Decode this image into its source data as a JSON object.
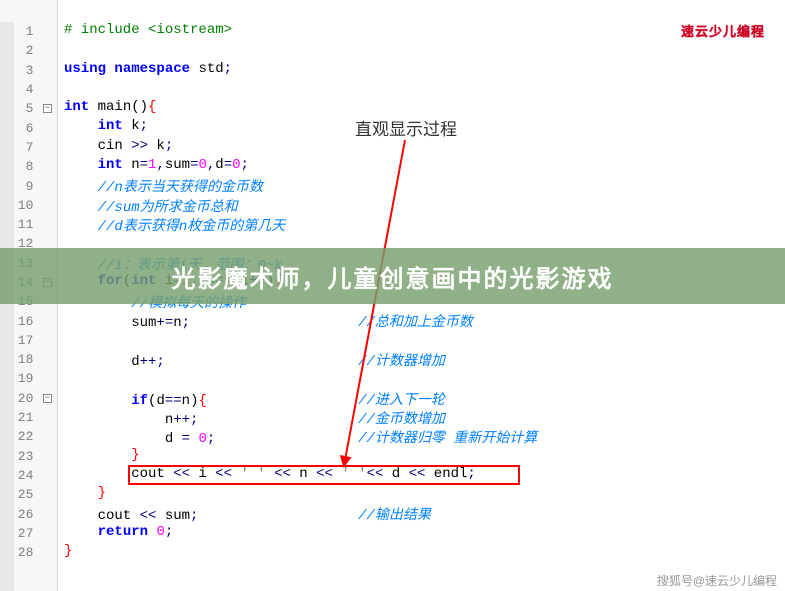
{
  "logo": {
    "main": "速云",
    "sub": "少儿编程"
  },
  "annotation": "直观显示过程",
  "overlay": "光影魔术师，儿童创意画中的光影游戏",
  "watermark": "搜狐号@速云少儿编程",
  "lines": [
    {
      "n": 1,
      "fold": null,
      "html": "<span class='pp'># include &lt;iostream&gt;</span>"
    },
    {
      "n": 2,
      "fold": null,
      "html": ""
    },
    {
      "n": 3,
      "fold": null,
      "html": "<span class='kw'>using</span> <span class='kw'>namespace</span> std<span class='op'>;</span>"
    },
    {
      "n": 4,
      "fold": null,
      "html": ""
    },
    {
      "n": 5,
      "fold": "box",
      "html": "<span class='kw'>int</span> <span class='fn'>main</span><span class='paren'>()</span><span class='brace'>{</span>"
    },
    {
      "n": 6,
      "fold": "line",
      "html": "    <span class='kw'>int</span> k<span class='op'>;</span>"
    },
    {
      "n": 7,
      "fold": "line",
      "html": "    cin <span class='op'>&gt;&gt;</span> k<span class='op'>;</span>"
    },
    {
      "n": 8,
      "fold": "line",
      "html": "    <span class='kw'>int</span> n<span class='op'>=</span><span class='num'>1</span><span class='op'>,</span>sum<span class='op'>=</span><span class='num'>0</span><span class='op'>,</span>d<span class='op'>=</span><span class='num'>0</span><span class='op'>;</span>"
    },
    {
      "n": 9,
      "fold": "line",
      "html": "    <span class='cm'>//n表示当天获得的金币数</span>"
    },
    {
      "n": 10,
      "fold": "line",
      "html": "    <span class='cm'>//sum为所求金币总和</span>"
    },
    {
      "n": 11,
      "fold": "line",
      "html": "    <span class='cm'>//d表示获得n枚金币的第几天</span>"
    },
    {
      "n": 12,
      "fold": "line",
      "html": ""
    },
    {
      "n": 13,
      "fold": "line",
      "html": "    <span class='cm'>//i：表示第i天，范围：0~k</span>"
    },
    {
      "n": 14,
      "fold": "box",
      "html": "    <span class='kw'>for</span><span class='paren'>(</span><span class='kw'>int</span> i<span class='op'>=</span><span class='num'>1</span><span class='op'>;</span>i<span class='op'>&lt;=</span>k<span class='op'>;</span>i<span class='op'>++</span><span class='paren'>)</span><span class='brace'>{</span>"
    },
    {
      "n": 15,
      "fold": "line",
      "html": "        <span class='cm'>//模拟每天的操作</span>"
    },
    {
      "n": 16,
      "fold": "line",
      "html": "        sum<span class='op'>+=</span>n<span class='op'>;</span>                    <span class='cm'>//总和加上金币数</span>"
    },
    {
      "n": 17,
      "fold": "line",
      "html": ""
    },
    {
      "n": 18,
      "fold": "line",
      "html": "        d<span class='op'>++;</span>                       <span class='cm'>//计数器增加</span>"
    },
    {
      "n": 19,
      "fold": "line",
      "html": ""
    },
    {
      "n": 20,
      "fold": "box",
      "html": "        <span class='kw'>if</span><span class='paren'>(</span>d<span class='op'>==</span>n<span class='paren'>)</span><span class='brace'>{</span>                  <span class='cm'>//进入下一轮</span>"
    },
    {
      "n": 21,
      "fold": "line",
      "html": "            n<span class='op'>++;</span>                   <span class='cm'>//金币数增加</span>"
    },
    {
      "n": 22,
      "fold": "line",
      "html": "            d <span class='op'>=</span> <span class='num'>0</span><span class='op'>;</span>                 <span class='cm'>//计数器归零 重新开始计算</span>"
    },
    {
      "n": 23,
      "fold": "line",
      "html": "        <span class='brace'>}</span>"
    },
    {
      "n": 24,
      "fold": "line",
      "html": "        cout <span class='op'>&lt;&lt;</span> i <span class='op'>&lt;&lt;</span> <span class='str'>' '</span> <span class='op'>&lt;&lt;</span> n <span class='op'>&lt;&lt;</span> <span class='str'>' '</span><span class='op'>&lt;&lt;</span> d <span class='op'>&lt;&lt;</span> endl<span class='op'>;</span>"
    },
    {
      "n": 25,
      "fold": "line",
      "html": "    <span class='brace'>}</span>"
    },
    {
      "n": 26,
      "fold": "line",
      "html": "    cout <span class='op'>&lt;&lt;</span> sum<span class='op'>;</span>                   <span class='cm'>//输出结果</span>"
    },
    {
      "n": 27,
      "fold": "line",
      "html": "    <span class='kw'>return</span> <span class='num'>0</span><span class='op'>;</span>"
    },
    {
      "n": 28,
      "fold": null,
      "html": "<span class='brace'>}</span>"
    }
  ]
}
